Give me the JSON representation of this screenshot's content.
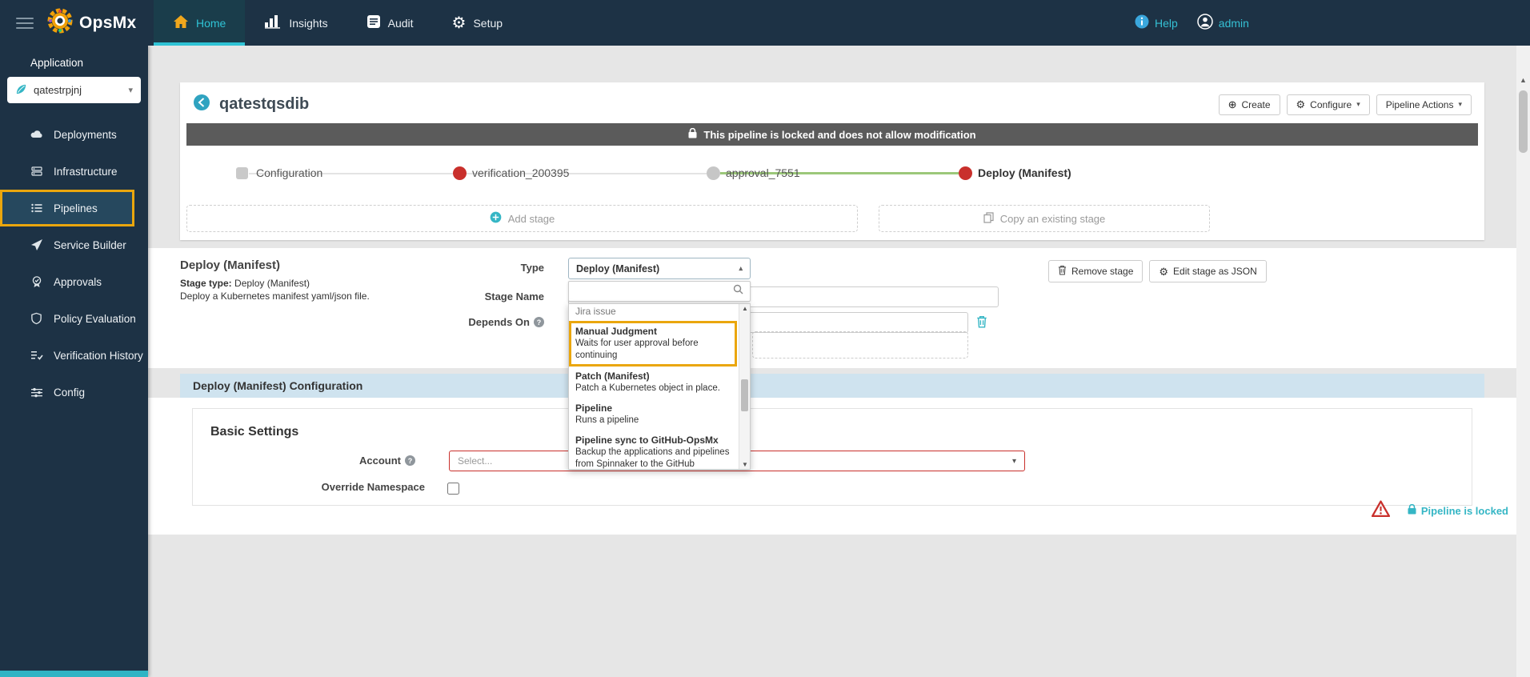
{
  "topbar": {
    "brand": "OpsMx",
    "nav": [
      {
        "label": "Home"
      },
      {
        "label": "Insights"
      },
      {
        "label": "Audit"
      },
      {
        "label": "Setup"
      }
    ],
    "help_label": "Help",
    "user_label": "admin"
  },
  "sidebar": {
    "section_label": "Application",
    "app_name": "qatestrpjnj",
    "items": [
      {
        "label": "Deployments"
      },
      {
        "label": "Infrastructure"
      },
      {
        "label": "Pipelines"
      },
      {
        "label": "Service Builder"
      },
      {
        "label": "Approvals"
      },
      {
        "label": "Policy Evaluation"
      },
      {
        "label": "Verification History"
      },
      {
        "label": "Config"
      }
    ]
  },
  "pipeline": {
    "title": "qatestqsdib",
    "create_label": "Create",
    "configure_label": "Configure",
    "actions_label": "Pipeline Actions",
    "locked_banner": "This pipeline is locked and does not allow modification",
    "stages": [
      {
        "label": "Configuration"
      },
      {
        "label": "verification_200395"
      },
      {
        "label": "approval_7551"
      },
      {
        "label": "Deploy (Manifest)"
      }
    ],
    "add_stage_label": "Add stage",
    "copy_stage_label": "Copy an existing stage"
  },
  "stage_editor": {
    "title": "Deploy (Manifest)",
    "stage_type_prefix": "Stage type:",
    "stage_type_value": " Deploy (Manifest)",
    "description": "Deploy a Kubernetes manifest yaml/json file.",
    "type_label": "Type",
    "stage_name_label": "Stage Name",
    "stage_name_value": "",
    "depends_on_label": "Depends On",
    "remove_stage_label": "Remove stage",
    "edit_json_label": "Edit stage as JSON"
  },
  "type_dropdown": {
    "selected": "Deploy (Manifest)",
    "search_value": "",
    "options": [
      {
        "title": "Jira issue",
        "desc": ""
      },
      {
        "title": "Manual Judgment",
        "desc": "Waits for user approval before continuing"
      },
      {
        "title": "Patch (Manifest)",
        "desc": "Patch a Kubernetes object in place."
      },
      {
        "title": "Pipeline",
        "desc": "Runs a pipeline"
      },
      {
        "title": "Pipeline sync to GitHub-OpsMx",
        "desc": "Backup the applications and pipelines from Spinnaker to the GitHub"
      }
    ]
  },
  "config_section": {
    "header": "Deploy (Manifest) Configuration",
    "basic_settings_title": "Basic Settings",
    "account_label": "Account",
    "account_placeholder": "Select...",
    "override_namespace_label": "Override Namespace"
  },
  "footer": {
    "locked_label": "Pipeline is locked"
  },
  "colors": {
    "topbar_bg": "#1d3245",
    "accent_cyan": "#2fc3d5",
    "highlight_yellow": "#eaa60d",
    "stage_red": "#c9302c",
    "stage_inactive_gray": "#c6c6c6",
    "connector_green": "#9cc87a",
    "locked_banner_bg": "#5b5b5b",
    "config_header_bg": "#cfe3ef",
    "error_red": "#c9302c"
  }
}
